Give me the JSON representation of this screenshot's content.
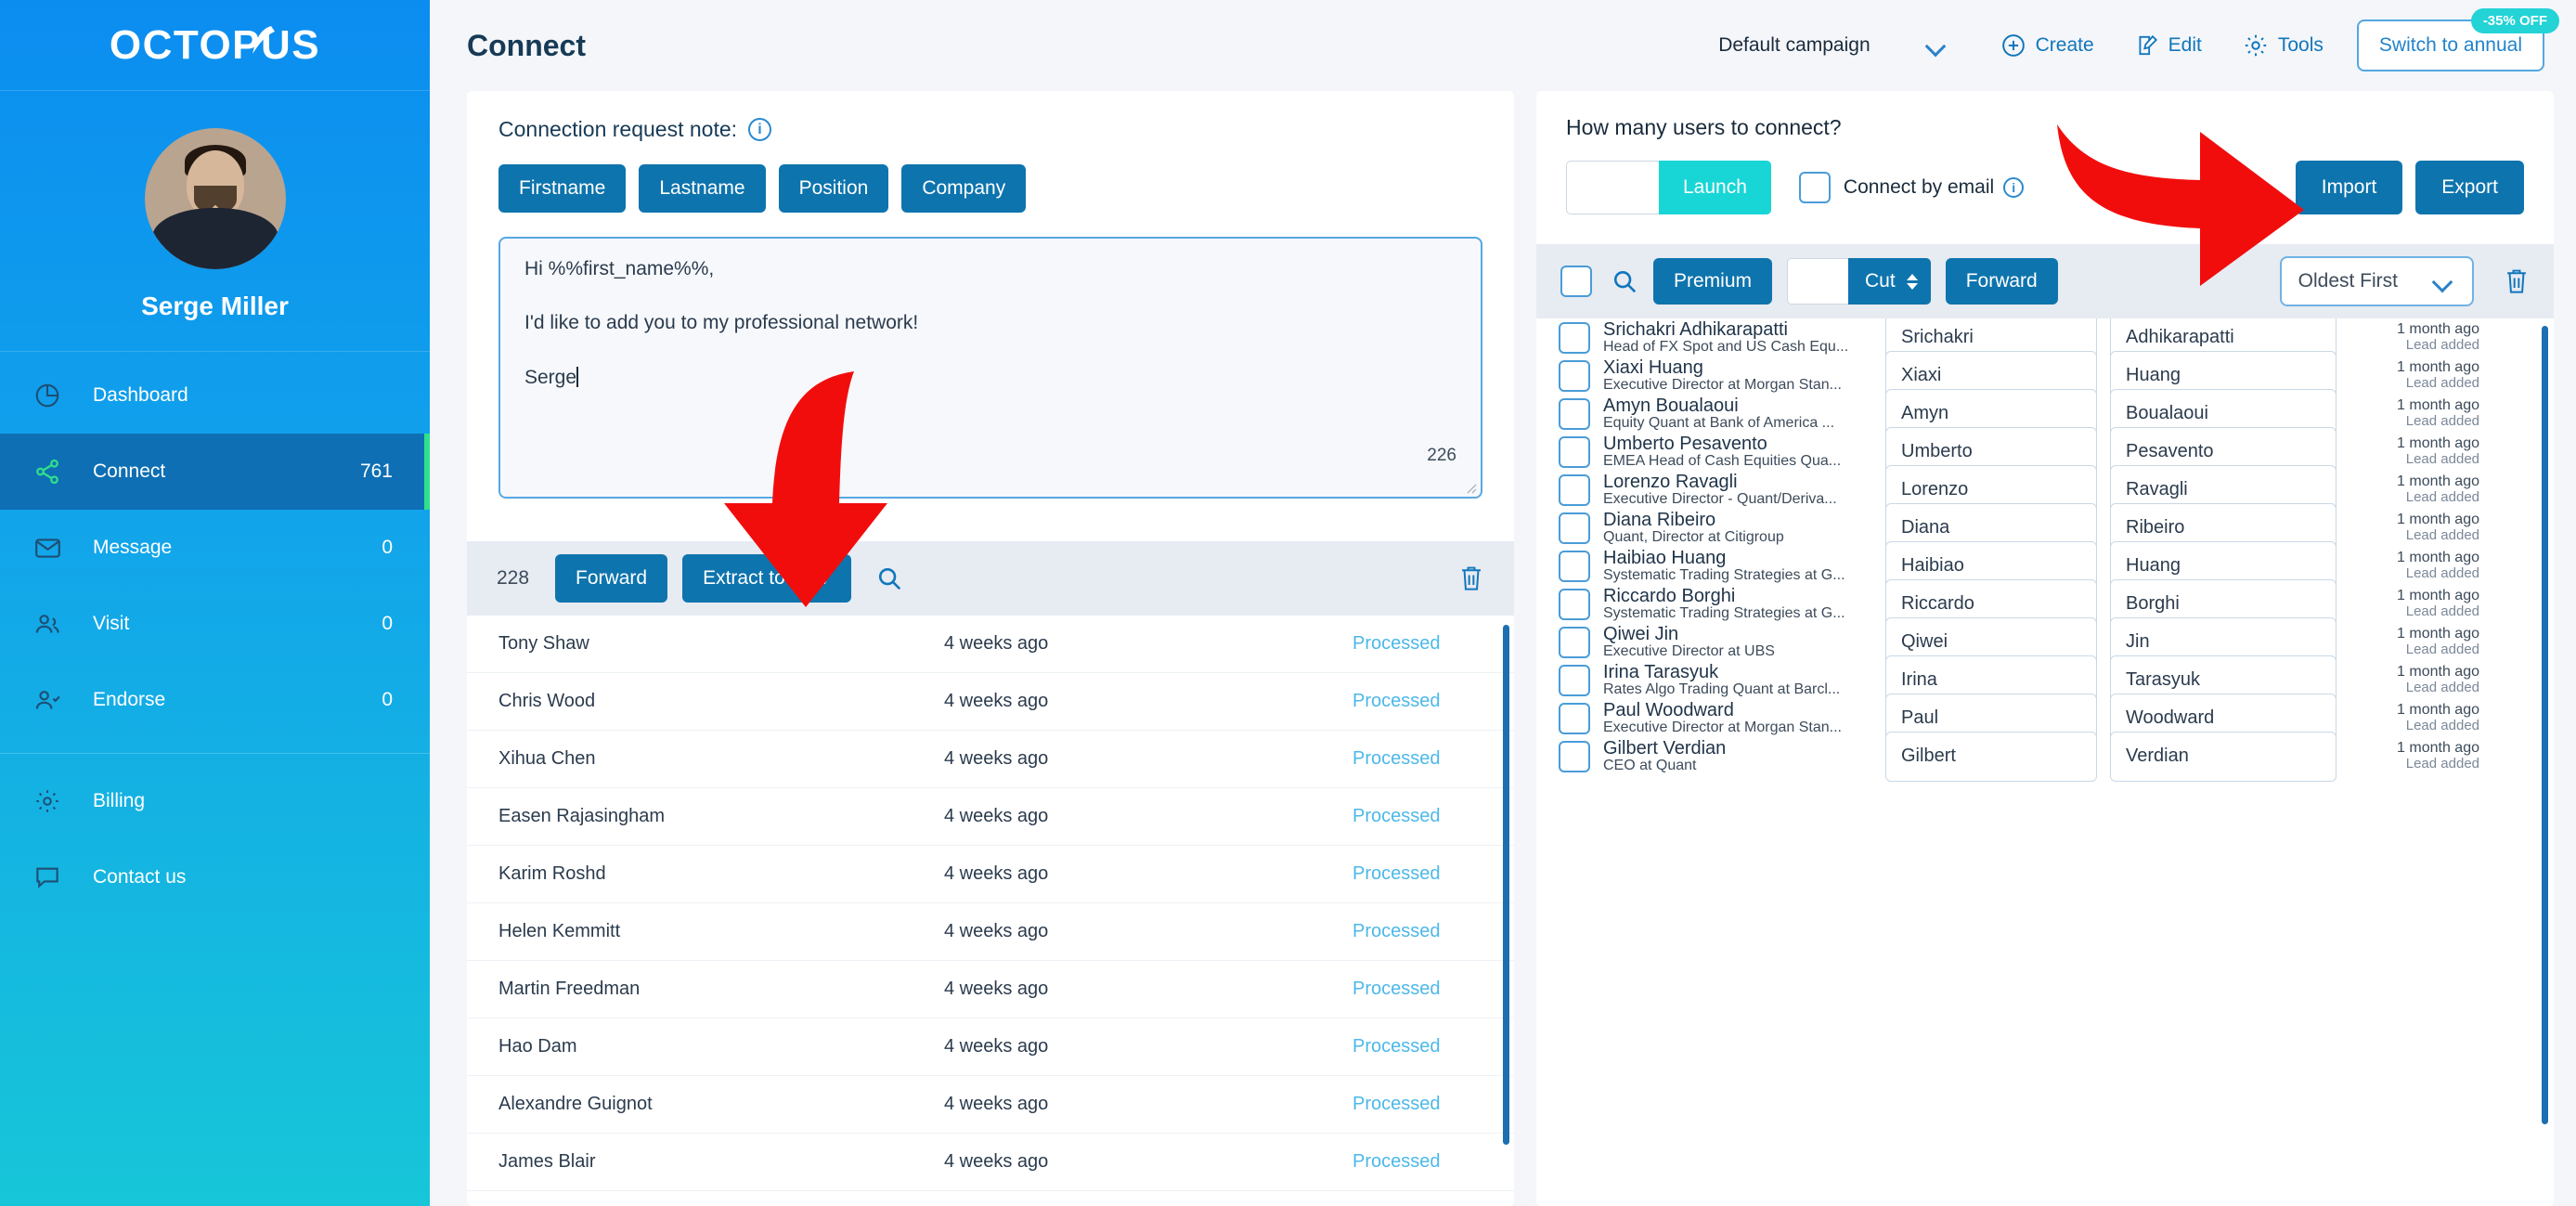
{
  "brand": {
    "logo_text": "OCTOPUS",
    "accent": "#0e74ad",
    "sidebar_start": "#0b8df0",
    "sidebar_end": "#17c6d8",
    "teal": "#18d6d6",
    "green": "#2fe08a",
    "red_arrow": "#f20d0d"
  },
  "sidebar": {
    "profile_name": "Serge Miller",
    "items": [
      {
        "label": "Dashboard",
        "count": "",
        "icon": "pie-chart-icon",
        "active": false
      },
      {
        "label": "Connect",
        "count": "761",
        "icon": "share-nodes-icon",
        "active": true
      },
      {
        "label": "Message",
        "count": "0",
        "icon": "envelope-icon",
        "active": false
      },
      {
        "label": "Visit",
        "count": "0",
        "icon": "users-icon",
        "active": false
      },
      {
        "label": "Endorse",
        "count": "0",
        "icon": "user-check-icon",
        "active": false
      },
      {
        "label": "Billing",
        "count": "",
        "icon": "gear-icon",
        "active": false
      },
      {
        "label": "Contact us",
        "count": "",
        "icon": "chat-bubble-icon",
        "active": false
      }
    ]
  },
  "header": {
    "title": "Connect",
    "campaign_value": "Default campaign",
    "create_label": "Create",
    "edit_label": "Edit",
    "tools_label": "Tools",
    "switch_label": "Switch to annual",
    "off_badge": "-35% OFF"
  },
  "note_panel": {
    "title": "Connection request note:",
    "tags": [
      "Firstname",
      "Lastname",
      "Position",
      "Company"
    ],
    "body_line1": "Hi %%first_name%%,",
    "body_line2": "I'd like to add you to my professional network!",
    "body_line3": "Serge",
    "char_count": "226"
  },
  "left_toolbar": {
    "count": "228",
    "forward_label": "Forward",
    "extract_label": "Extract to CSV",
    "search_icon": "search-icon",
    "delete_icon": "trash-icon"
  },
  "processed_list": {
    "rows": [
      {
        "name": "Tony Shaw",
        "ago": "4 weeks ago",
        "status": "Processed"
      },
      {
        "name": "Chris Wood",
        "ago": "4 weeks ago",
        "status": "Processed"
      },
      {
        "name": "Xihua Chen",
        "ago": "4 weeks ago",
        "status": "Processed"
      },
      {
        "name": "Easen Rajasingham",
        "ago": "4 weeks ago",
        "status": "Processed"
      },
      {
        "name": "Karim Roshd",
        "ago": "4 weeks ago",
        "status": "Processed"
      },
      {
        "name": "Helen Kemmitt",
        "ago": "4 weeks ago",
        "status": "Processed"
      },
      {
        "name": "Martin Freedman",
        "ago": "4 weeks ago",
        "status": "Processed"
      },
      {
        "name": "Hao Dam",
        "ago": "4 weeks ago",
        "status": "Processed"
      },
      {
        "name": "Alexandre Guignot",
        "ago": "4 weeks ago",
        "status": "Processed"
      },
      {
        "name": "James Blair",
        "ago": "4 weeks ago",
        "status": "Processed"
      }
    ]
  },
  "right_panel": {
    "question": "How many users to connect?",
    "users_input_value": "",
    "launch_label": "Launch",
    "connect_by_email_label": "Connect by email",
    "connect_by_email_checked": false,
    "import_label": "Import",
    "export_label": "Export",
    "toolbar": {
      "select_all_checked": false,
      "search_icon": "search-icon",
      "premium_label": "Premium",
      "cut_input_value": "",
      "cut_label": "Cut",
      "forward_label": "Forward",
      "sort_value": "Oldest First",
      "delete_icon": "trash-icon"
    },
    "contacts": [
      {
        "name": "Srichakri Adhikarapatti",
        "title": "Head of FX Spot and US Cash Equ...",
        "first": "Srichakri",
        "last": "Adhikarapatti",
        "ago": "1 month ago",
        "event": "Lead added"
      },
      {
        "name": "Xiaxi Huang",
        "title": "Executive Director at Morgan Stan...",
        "first": "Xiaxi",
        "last": "Huang",
        "ago": "1 month ago",
        "event": "Lead added"
      },
      {
        "name": "Amyn Boualaoui",
        "title": "Equity Quant at Bank of America ...",
        "first": "Amyn",
        "last": "Boualaoui",
        "ago": "1 month ago",
        "event": "Lead added"
      },
      {
        "name": "Umberto Pesavento",
        "title": "EMEA Head of Cash Equities Qua...",
        "first": "Umberto",
        "last": "Pesavento",
        "ago": "1 month ago",
        "event": "Lead added"
      },
      {
        "name": "Lorenzo Ravagli",
        "title": "Executive Director - Quant/Deriva...",
        "first": "Lorenzo",
        "last": "Ravagli",
        "ago": "1 month ago",
        "event": "Lead added"
      },
      {
        "name": "Diana Ribeiro",
        "title": "Quant, Director at Citigroup",
        "first": "Diana",
        "last": "Ribeiro",
        "ago": "1 month ago",
        "event": "Lead added"
      },
      {
        "name": "Haibiao Huang",
        "title": "Systematic Trading Strategies at G...",
        "first": "Haibiao",
        "last": "Huang",
        "ago": "1 month ago",
        "event": "Lead added"
      },
      {
        "name": "Riccardo Borghi",
        "title": "Systematic Trading Strategies at G...",
        "first": "Riccardo",
        "last": "Borghi",
        "ago": "1 month ago",
        "event": "Lead added"
      },
      {
        "name": "Qiwei Jin",
        "title": "Executive Director at UBS",
        "first": "Qiwei",
        "last": "Jin",
        "ago": "1 month ago",
        "event": "Lead added"
      },
      {
        "name": "Irina Tarasyuk",
        "title": "Rates Algo Trading Quant at Barcl...",
        "first": "Irina",
        "last": "Tarasyuk",
        "ago": "1 month ago",
        "event": "Lead added"
      },
      {
        "name": "Paul Woodward",
        "title": "Executive Director at Morgan Stan...",
        "first": "Paul",
        "last": "Woodward",
        "ago": "1 month ago",
        "event": "Lead added"
      },
      {
        "name": "Gilbert Verdian",
        "title": "CEO at Quant",
        "first": "Gilbert",
        "last": "Verdian",
        "ago": "1 month ago",
        "event": "Lead added"
      }
    ]
  },
  "annotations": [
    {
      "name": "arrow-down-extract-csv",
      "shape": "curved-arrow-down"
    },
    {
      "name": "arrow-right-import",
      "shape": "curved-arrow-right"
    }
  ]
}
